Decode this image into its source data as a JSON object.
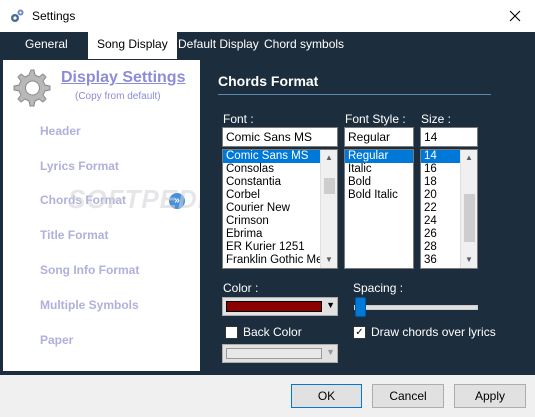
{
  "window": {
    "title": "Settings"
  },
  "tabs": [
    {
      "label": "General"
    },
    {
      "label": "Song Display"
    },
    {
      "label": "Default Display"
    },
    {
      "label": "Chord symbols"
    }
  ],
  "sidebar": {
    "title": "Display Settings",
    "subtitle": "(Copy from default)",
    "items": [
      {
        "label": "Header"
      },
      {
        "label": "Lyrics Format"
      },
      {
        "label": "Chords Format"
      },
      {
        "label": "Title Format"
      },
      {
        "label": "Song Info Format"
      },
      {
        "label": "Multiple Symbols"
      },
      {
        "label": "Paper"
      }
    ],
    "watermark": "SOFTPEDIA"
  },
  "panel": {
    "title": "Chords Format",
    "font": {
      "label": "Font :",
      "value": "Comic Sans MS",
      "options": [
        "Comic Sans MS",
        "Consolas",
        "Constantia",
        "Corbel",
        "Courier New",
        "Crimson",
        "Ebrima",
        "ER Kurier 1251",
        "Franklin Gothic Med"
      ]
    },
    "font_style": {
      "label": "Font Style :",
      "value": "Regular",
      "options": [
        "Regular",
        "Italic",
        "Bold",
        "Bold Italic"
      ]
    },
    "size": {
      "label": "Size :",
      "value": "14",
      "options": [
        "14",
        "16",
        "18",
        "20",
        "22",
        "24",
        "26",
        "28",
        "36"
      ]
    },
    "color": {
      "label": "Color :",
      "value": "#8b0000"
    },
    "back_color": {
      "label": "Back Color",
      "checked": false
    },
    "spacing": {
      "label": "Spacing :",
      "value": 0
    },
    "draw_over": {
      "label": "Draw chords over lyrics",
      "checked": true
    }
  },
  "buttons": {
    "ok": "OK",
    "cancel": "Cancel",
    "apply": "Apply"
  },
  "icons": {
    "app": "settings-gear-icon",
    "close": "close-icon",
    "section": "gear-icon",
    "nav_arrow": "double-chevron-right-icon"
  }
}
